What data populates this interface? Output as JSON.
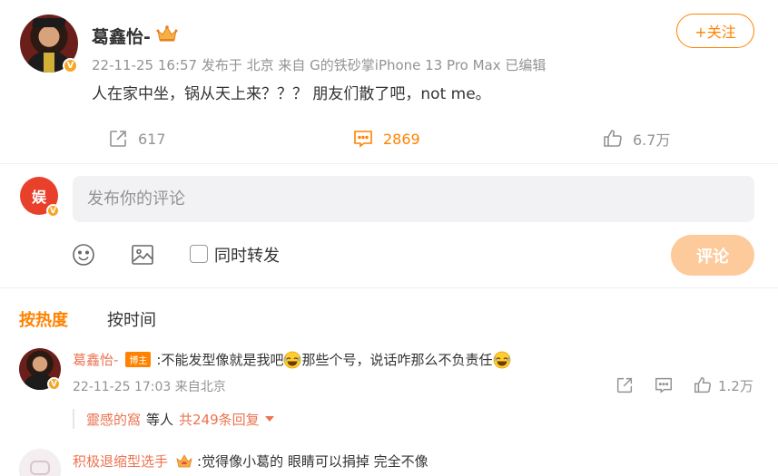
{
  "post": {
    "author": "葛鑫怡-",
    "meta": "22-11-25 16:57 发布于 北京 来自 G的铁砂掌iPhone 13 Pro Max 已编辑",
    "text": "人在家中坐，锅从天上来？？？ 朋友们散了吧，not me。",
    "follow_label": "+关注",
    "verified_mark": "V",
    "actions": {
      "share_count": "617",
      "comment_count": "2869",
      "like_count": "6.7万"
    }
  },
  "compose": {
    "placeholder": "发布你的评论",
    "repost_label": "同时转发",
    "submit_label": "评论",
    "avatar_text": "娱"
  },
  "sort_tabs": {
    "hot": "按热度",
    "time": "按时间"
  },
  "comments": [
    {
      "user": "葛鑫怡-",
      "badge": "博主",
      "text_a": ":不能发型像就是我吧",
      "text_b": "那些个号，说话咋那么不负责任",
      "meta": "22-11-25 17:03 来自北京",
      "like_count": "1.2万",
      "reply_summary": {
        "user": "靈感的窩",
        "text": "等人",
        "total": "共249条回复"
      }
    },
    {
      "user": "积极退缩型选手",
      "text": ":觉得像小葛的 眼睛可以捐掉 完全不像"
    }
  ],
  "colors": {
    "accent": "#ff8200",
    "username": "#eb7350",
    "muted": "#939393",
    "submit_disabled": "#fdcb9b"
  }
}
